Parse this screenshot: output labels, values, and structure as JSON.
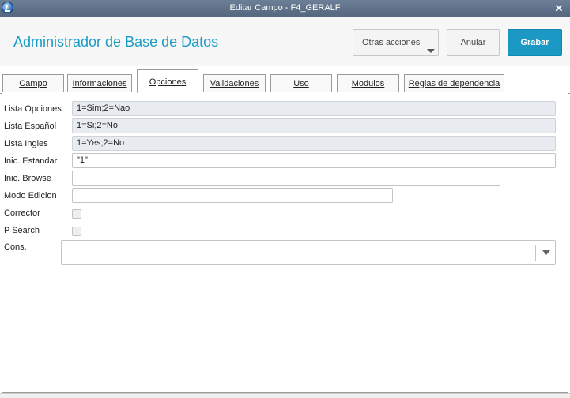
{
  "window": {
    "title": "Editar Campo - F4_GERALF"
  },
  "header": {
    "app_title": "Administrador de Base de Datos",
    "otras_acciones": "Otras acciones",
    "anular": "Anular",
    "grabar": "Grabar"
  },
  "tabs": [
    {
      "label": "Campo"
    },
    {
      "label": "Informaciones"
    },
    {
      "label": "Opciones"
    },
    {
      "label": "Validaciones"
    },
    {
      "label": "Uso"
    },
    {
      "label": "Modulos"
    },
    {
      "label": "Reglas de dependencia"
    }
  ],
  "active_tab": "Opciones",
  "form": {
    "lista_opciones": {
      "label": "Lista Opciones",
      "value": "1=Sim;2=Nao"
    },
    "lista_espanol": {
      "label": "Lista Español",
      "value": "1=Si;2=No"
    },
    "lista_ingles": {
      "label": "Lista Ingles",
      "value": "1=Yes;2=No"
    },
    "inic_estandar": {
      "label": "Inic. Estandar",
      "value": "\"1\""
    },
    "inic_browse": {
      "label": "Inic. Browse",
      "value": ""
    },
    "modo_edicion": {
      "label": "Modo Edicion",
      "value": ""
    },
    "corrector": {
      "label": "Corrector",
      "checked": false
    },
    "p_search": {
      "label": "P Search",
      "checked": false
    },
    "cons": {
      "label": "Cons.",
      "value": ""
    }
  },
  "colors": {
    "accent": "#1b98c4",
    "title_text": "#1a9cc7",
    "titlebar": "#5f718a",
    "readonly_field": "#e8ebef"
  },
  "icons": {
    "app": "app-logo-icon",
    "close": "close-icon",
    "dropdown": "chevron-down-icon"
  }
}
